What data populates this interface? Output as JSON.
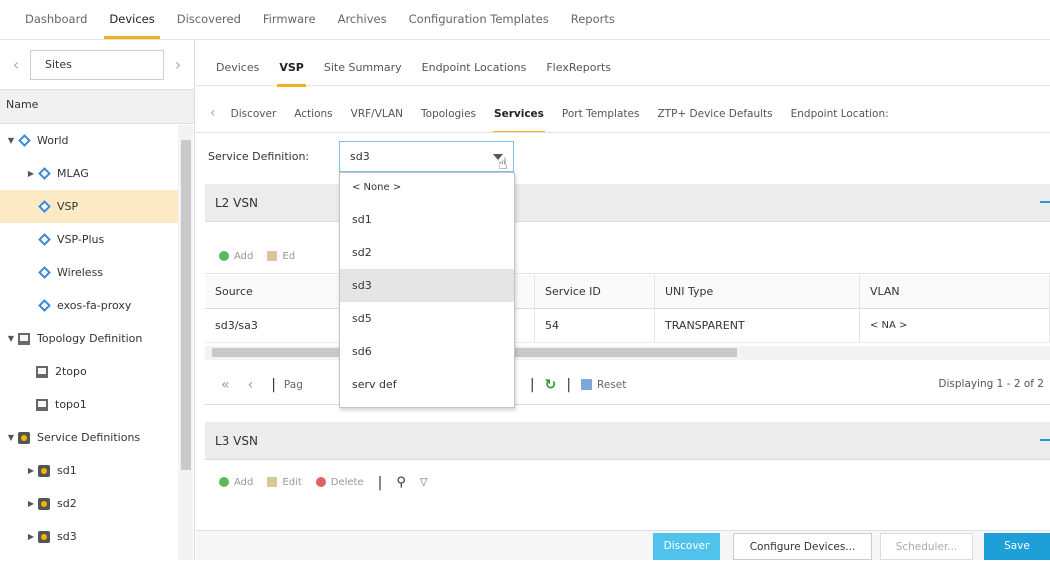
{
  "top_nav": [
    "Dashboard",
    "Devices",
    "Discovered",
    "Firmware",
    "Archives",
    "Configuration Templates",
    "Reports"
  ],
  "sidebar": {
    "site_selector": "Sites",
    "name_header": "Name",
    "tree": [
      {
        "label": "World",
        "icon": "site-icon",
        "expand": "▼"
      },
      {
        "label": "MLAG",
        "icon": "site-icon",
        "expand": "▶"
      },
      {
        "label": "VSP",
        "icon": "site-icon",
        "expand": ""
      },
      {
        "label": "VSP-Plus",
        "icon": "site-icon",
        "expand": ""
      },
      {
        "label": "Wireless",
        "icon": "site-icon",
        "expand": ""
      },
      {
        "label": "exos-fa-proxy",
        "icon": "site-icon",
        "expand": ""
      },
      {
        "label": "Topology Definition",
        "icon": "topology-icon",
        "expand": "▼"
      },
      {
        "label": "2topo",
        "icon": "topology-icon",
        "expand": ""
      },
      {
        "label": "topo1",
        "icon": "topology-icon",
        "expand": ""
      },
      {
        "label": "Service Definitions",
        "icon": "service-icon",
        "expand": "▼"
      },
      {
        "label": "sd1",
        "icon": "service-icon",
        "expand": "▶"
      },
      {
        "label": "sd2",
        "icon": "service-icon",
        "expand": "▶"
      },
      {
        "label": "sd3",
        "icon": "service-icon",
        "expand": "▶"
      }
    ]
  },
  "sub_tabs": [
    "Devices",
    "VSP",
    "Site Summary",
    "Endpoint Locations",
    "FlexReports"
  ],
  "vsp_tabs": [
    "Discover",
    "Actions",
    "VRF/VLAN",
    "Topologies",
    "Services",
    "Port Templates",
    "ZTP+ Device Defaults",
    "Endpoint Location:"
  ],
  "service_definition": {
    "label": "Service Definition:",
    "value": "sd3",
    "options": [
      "< None >",
      "sd1",
      "sd2",
      "sd3",
      "sd5",
      "sd6",
      "serv def"
    ]
  },
  "l2vsn": {
    "title": "L2 VSN",
    "toolbar": {
      "add": "Add",
      "edit": "Ed"
    },
    "columns": [
      "Source",
      "",
      "Service ID",
      "UNI Type",
      "VLAN"
    ],
    "rows": [
      [
        "sd3/sa3",
        "",
        "54",
        "TRANSPARENT",
        "< NA >"
      ]
    ],
    "pager": {
      "page_label": "Pag",
      "reset": "Reset",
      "displaying": "Displaying 1 - 2 of 2"
    }
  },
  "l3vsn": {
    "title": "L3 VSN",
    "toolbar": {
      "add": "Add",
      "edit": "Edit",
      "delete": "Delete"
    }
  },
  "buttons": {
    "discover": "Discover",
    "configure": "Configure Devices...",
    "scheduler": "Scheduler...",
    "save": "Save"
  }
}
